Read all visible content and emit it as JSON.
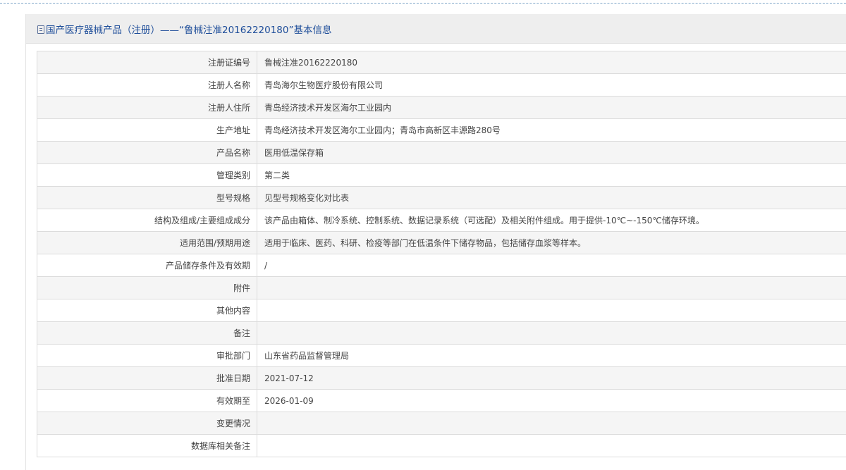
{
  "header": {
    "icon": "document-icon",
    "title": "国产医疗器械产品（注册）——“鲁械注准20162220180”基本信息"
  },
  "rows": [
    {
      "label": "注册证编号",
      "value": "鲁械注准20162220180"
    },
    {
      "label": "注册人名称",
      "value": "青岛海尔生物医疗股份有限公司"
    },
    {
      "label": "注册人住所",
      "value": "青岛经济技术开发区海尔工业园内"
    },
    {
      "label": "生产地址",
      "value": "青岛经济技术开发区海尔工业园内；青岛市高新区丰源路280号"
    },
    {
      "label": "产品名称",
      "value": "医用低温保存箱"
    },
    {
      "label": "管理类别",
      "value": "第二类"
    },
    {
      "label": "型号规格",
      "value": "见型号规格变化对比表"
    },
    {
      "label": "结构及组成/主要组成成分",
      "value": "该产品由箱体、制冷系统、控制系统、数据记录系统（可选配）及相关附件组成。用于提供-10℃~-150℃储存环境。"
    },
    {
      "label": "适用范围/预期用途",
      "value": "适用于临床、医药、科研、检疫等部门在低温条件下储存物品，包括储存血浆等样本。"
    },
    {
      "label": "产品储存条件及有效期",
      "value": "/"
    },
    {
      "label": "附件",
      "value": ""
    },
    {
      "label": "其他内容",
      "value": ""
    },
    {
      "label": "备注",
      "value": ""
    },
    {
      "label": "审批部门",
      "value": "山东省药品监督管理局"
    },
    {
      "label": "批准日期",
      "value": "2021-07-12"
    },
    {
      "label": "有效期至",
      "value": "2026-01-09"
    },
    {
      "label": "变更情况",
      "value": ""
    },
    {
      "label": "数据库相关备注",
      "value": ""
    }
  ]
}
